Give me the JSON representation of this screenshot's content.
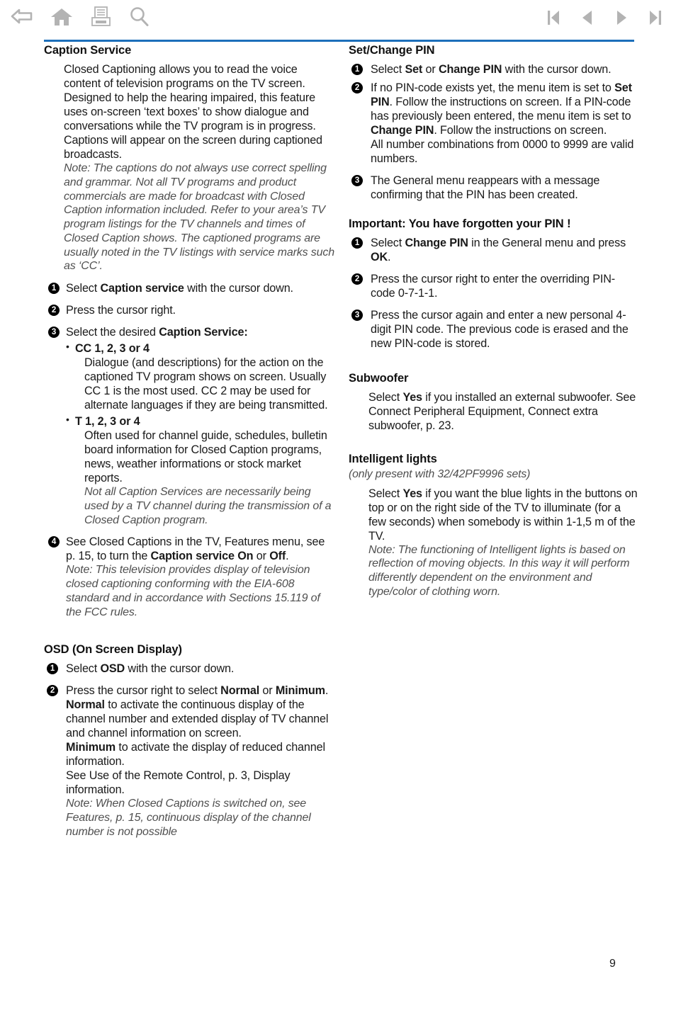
{
  "toolbar": {
    "left_icons": [
      {
        "name": "back-arrow-icon",
        "label": "Back"
      },
      {
        "name": "home-icon",
        "label": "Home"
      },
      {
        "name": "print-icon",
        "label": "Print"
      },
      {
        "name": "search-icon",
        "label": "Search"
      }
    ],
    "right_icons": [
      {
        "name": "first-page-icon",
        "label": "First page"
      },
      {
        "name": "previous-page-icon",
        "label": "Previous page"
      },
      {
        "name": "next-page-icon",
        "label": "Next page"
      },
      {
        "name": "last-page-icon",
        "label": "Last page"
      }
    ],
    "rule_color": "#1c6fba",
    "icon_color": "#b3b3b3"
  },
  "page_number": "9",
  "left_column": {
    "caption_service": {
      "heading": "Caption Service",
      "intro": "Closed Captioning allows you to read the voice content of television programs on the TV screen. Designed to help the hearing impaired, this feature uses on-screen ‘text boxes’ to show dialogue and conversations while the TV program is in progress. Captions will appear on the screen during captioned broadcasts.",
      "intro_note": "Note: The captions do not always use correct spelling and grammar. Not all TV programs and product commercials are made for broadcast with Closed Caption information included. Refer to your area’s TV program listings for the TV channels and times of Closed Caption shows. The captioned programs are usually noted in the TV listings with service marks such as ‘CC’.",
      "step1_pre": "Select ",
      "step1_bold": "Caption service",
      "step1_post": " with the cursor down.",
      "step2": "Press the cursor right.",
      "step3_pre": "Select the desired ",
      "step3_bold": "Caption Service:",
      "bullet_cc_title": "CC 1, 2, 3 or 4",
      "bullet_cc_body": "Dialogue (and descriptions) for the action on the captioned TV program shows on screen. Usually CC 1 is the most used. CC 2 may be used for alternate languages if they are being transmitted.",
      "bullet_t_title": "T 1, 2, 3 or 4",
      "bullet_t_body": "Often used for channel guide, schedules, bulletin board information for Closed Caption programs, news, weather informations or stock market reports.",
      "bullet_t_note": "Not all Caption Services are necessarily being used by a TV channel during the transmission of a Closed Caption program.",
      "step4_pre": "See Closed Captions in the TV, Features menu, see p. 15, to turn the ",
      "step4_bold1": "Caption service On",
      "step4_mid": " or ",
      "step4_bold2": "Off",
      "step4_post": ".",
      "step4_note": "Note: This television provides display of television closed captioning conforming with the EIA-608 standard and in accordance with Sections 15.119 of the FCC rules."
    },
    "osd": {
      "heading": "OSD (On Screen Display)",
      "step1_pre": "Select ",
      "step1_bold": "OSD",
      "step1_post": " with the cursor down.",
      "step2_pre": "Press the cursor right to select ",
      "step2_bold1": "Normal",
      "step2_mid": " or ",
      "step2_bold2": "Minimum",
      "step2_post": ".",
      "step2_line2_bold": "Normal",
      "step2_line2_rest": " to activate the continuous display of the channel number and extended display of TV channel and channel information on screen.",
      "step2_line3_bold": "Minimum",
      "step2_line3_rest": " to activate the display of reduced channel information.",
      "step2_line4": "See Use of the Remote Control, p. 3, Display information.",
      "step2_note": "Note: When Closed Captions is switched on, see Features, p. 15, continuous display of the channel number is not possible"
    }
  },
  "right_column": {
    "set_change_pin": {
      "heading": "Set/Change PIN",
      "step1_pre": "Select ",
      "step1_bold1": "Set",
      "step1_mid": " or ",
      "step1_bold2": "Change PIN",
      "step1_post": " with the cursor down.",
      "step2_pre": "If no PIN-code exists yet, the menu item is set to ",
      "step2_bold1": "Set PIN",
      "step2_mid": ". Follow the instructions on screen. If a PIN-code has previously been entered, the menu item is set to ",
      "step2_bold2": "Change PIN",
      "step2_post": ". Follow the instructions on screen.",
      "step2_line2": "All number combinations from 0000 to 9999 are valid numbers.",
      "step3": "The General menu reappears with a message confirming that the PIN has been created."
    },
    "forgotten_pin": {
      "heading": "Important: You have forgotten your PIN !",
      "step1_pre": "Select ",
      "step1_bold1": "Change PIN",
      "step1_mid": " in the General menu and press ",
      "step1_bold2": "OK",
      "step1_post": ".",
      "step2": "Press the cursor right to enter the overriding PIN-code 0-7-1-1.",
      "step3": "Press the cursor again and enter a new personal 4-digit PIN code. The previous code is erased and the new PIN-code is stored."
    },
    "subwoofer": {
      "heading": "Subwoofer",
      "body_pre": "Select ",
      "body_bold": "Yes",
      "body_post": " if you installed an external subwoofer. See Connect Peripheral Equipment, Connect extra subwoofer, p. 23."
    },
    "intelligent_lights": {
      "heading": "Intelligent lights",
      "subtitle": "(only present with 32/42PF9996 sets)",
      "body_pre": "Select ",
      "body_bold": "Yes",
      "body_post": " if you want the blue lights in the buttons on top or on the right side of the TV to illuminate (for a few seconds) when somebody is within 1-1,5 m of the TV.",
      "note": "Note: The functioning of Intelligent lights is based on reflection of moving objects. In this way it will perform differently dependent on the environment and type/color of clothing worn."
    }
  }
}
